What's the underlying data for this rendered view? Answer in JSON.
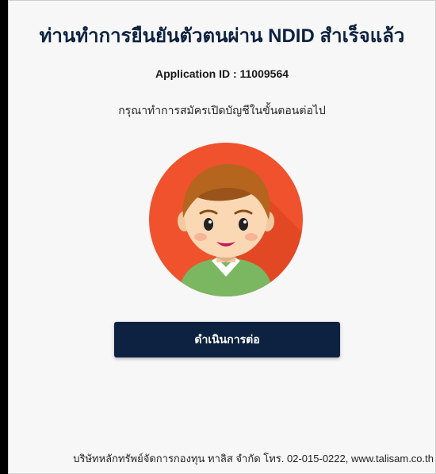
{
  "header": {
    "title": "ท่านทำการยืนยันตัวตนผ่าน NDID สำเร็จแล้ว"
  },
  "application": {
    "id_text": "Application ID : 11009564"
  },
  "instruction": "กรุณาทำการสมัครเปิดบัญชีในขั้นตอนต่อไป",
  "avatar": {
    "icon": "user-avatar-icon",
    "background_color": "#f0522d",
    "shirt_color": "#7bb661",
    "hair_color": "#b5651d"
  },
  "actions": {
    "continue_label": "ดำเนินการต่อ"
  },
  "footer": {
    "text": "บริษัทหลักทรัพย์จัดการกองทุน ทาลิส จำกัด โทร. 02-015-0222, www.talisam.co.th"
  },
  "colors": {
    "primary": "#0d2240",
    "page_background": "#f7f7f7"
  }
}
